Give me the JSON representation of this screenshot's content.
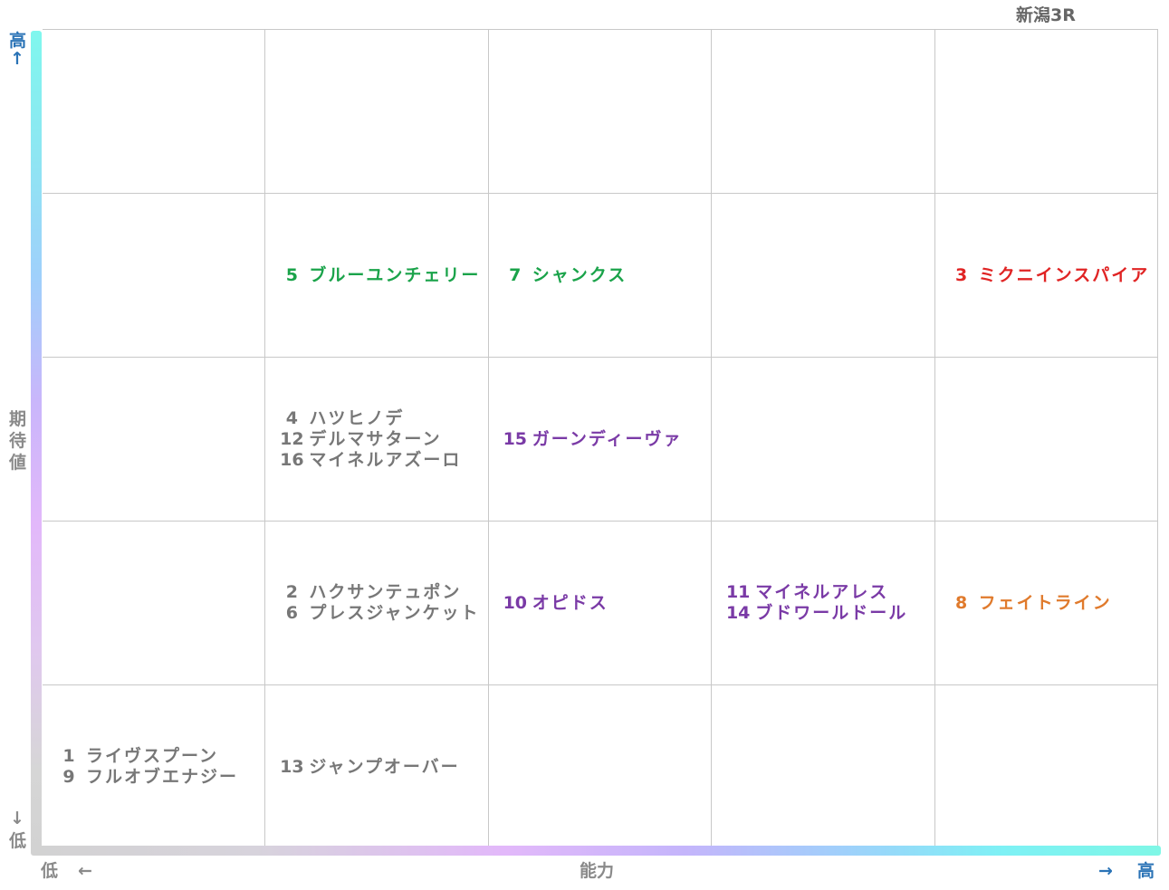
{
  "title": "新潟3R",
  "y_axis": {
    "high": "高",
    "high_arrow": "↑",
    "label": [
      "期",
      "待",
      "値"
    ],
    "low_arrow": "↓",
    "low": "低"
  },
  "x_axis": {
    "low": "低",
    "low_arrow": "←",
    "label": "能力",
    "high_arrow": "→",
    "high": "高"
  },
  "colors": {
    "green": "#1aa34a",
    "red": "#e02424",
    "purple": "#7a3aa6",
    "orange": "#e07a2c",
    "gray": "#777777",
    "grid": "#c8c8c8"
  },
  "chart_data": {
    "type": "table",
    "columns": 5,
    "rows": 5,
    "cells": [
      {
        "row": 2,
        "col": 2,
        "color": "green",
        "entries": [
          {
            "num": "5",
            "name": "ブルーユンチェリー"
          }
        ]
      },
      {
        "row": 2,
        "col": 3,
        "color": "green",
        "entries": [
          {
            "num": "7",
            "name": "シャンクス"
          }
        ]
      },
      {
        "row": 2,
        "col": 5,
        "color": "red",
        "entries": [
          {
            "num": "3",
            "name": "ミクニインスパイア"
          }
        ]
      },
      {
        "row": 3,
        "col": 2,
        "color": "gray",
        "entries": [
          {
            "num": "4",
            "name": "ハツヒノデ"
          },
          {
            "num": "12",
            "name": "デルマサターン"
          },
          {
            "num": "16",
            "name": "マイネルアズーロ"
          }
        ]
      },
      {
        "row": 3,
        "col": 3,
        "color": "purple",
        "entries": [
          {
            "num": "15",
            "name": "ガーンディーヴァ"
          }
        ]
      },
      {
        "row": 4,
        "col": 2,
        "color": "gray",
        "entries": [
          {
            "num": "2",
            "name": "ハクサンテュポン"
          },
          {
            "num": "6",
            "name": "プレスジャンケット"
          }
        ]
      },
      {
        "row": 4,
        "col": 3,
        "color": "purple",
        "entries": [
          {
            "num": "10",
            "name": "オピドス"
          }
        ]
      },
      {
        "row": 4,
        "col": 4,
        "color": "purple",
        "entries": [
          {
            "num": "11",
            "name": "マイネルアレス"
          },
          {
            "num": "14",
            "name": "ブドワールドール"
          }
        ]
      },
      {
        "row": 4,
        "col": 5,
        "color": "orange",
        "entries": [
          {
            "num": "8",
            "name": "フェイトライン"
          }
        ]
      },
      {
        "row": 5,
        "col": 1,
        "color": "gray",
        "entries": [
          {
            "num": "1",
            "name": "ライヴスプーン"
          },
          {
            "num": "9",
            "name": "フルオブエナジー"
          }
        ]
      },
      {
        "row": 5,
        "col": 2,
        "color": "gray",
        "entries": [
          {
            "num": "13",
            "name": "ジャンプオーバー"
          }
        ]
      }
    ]
  }
}
